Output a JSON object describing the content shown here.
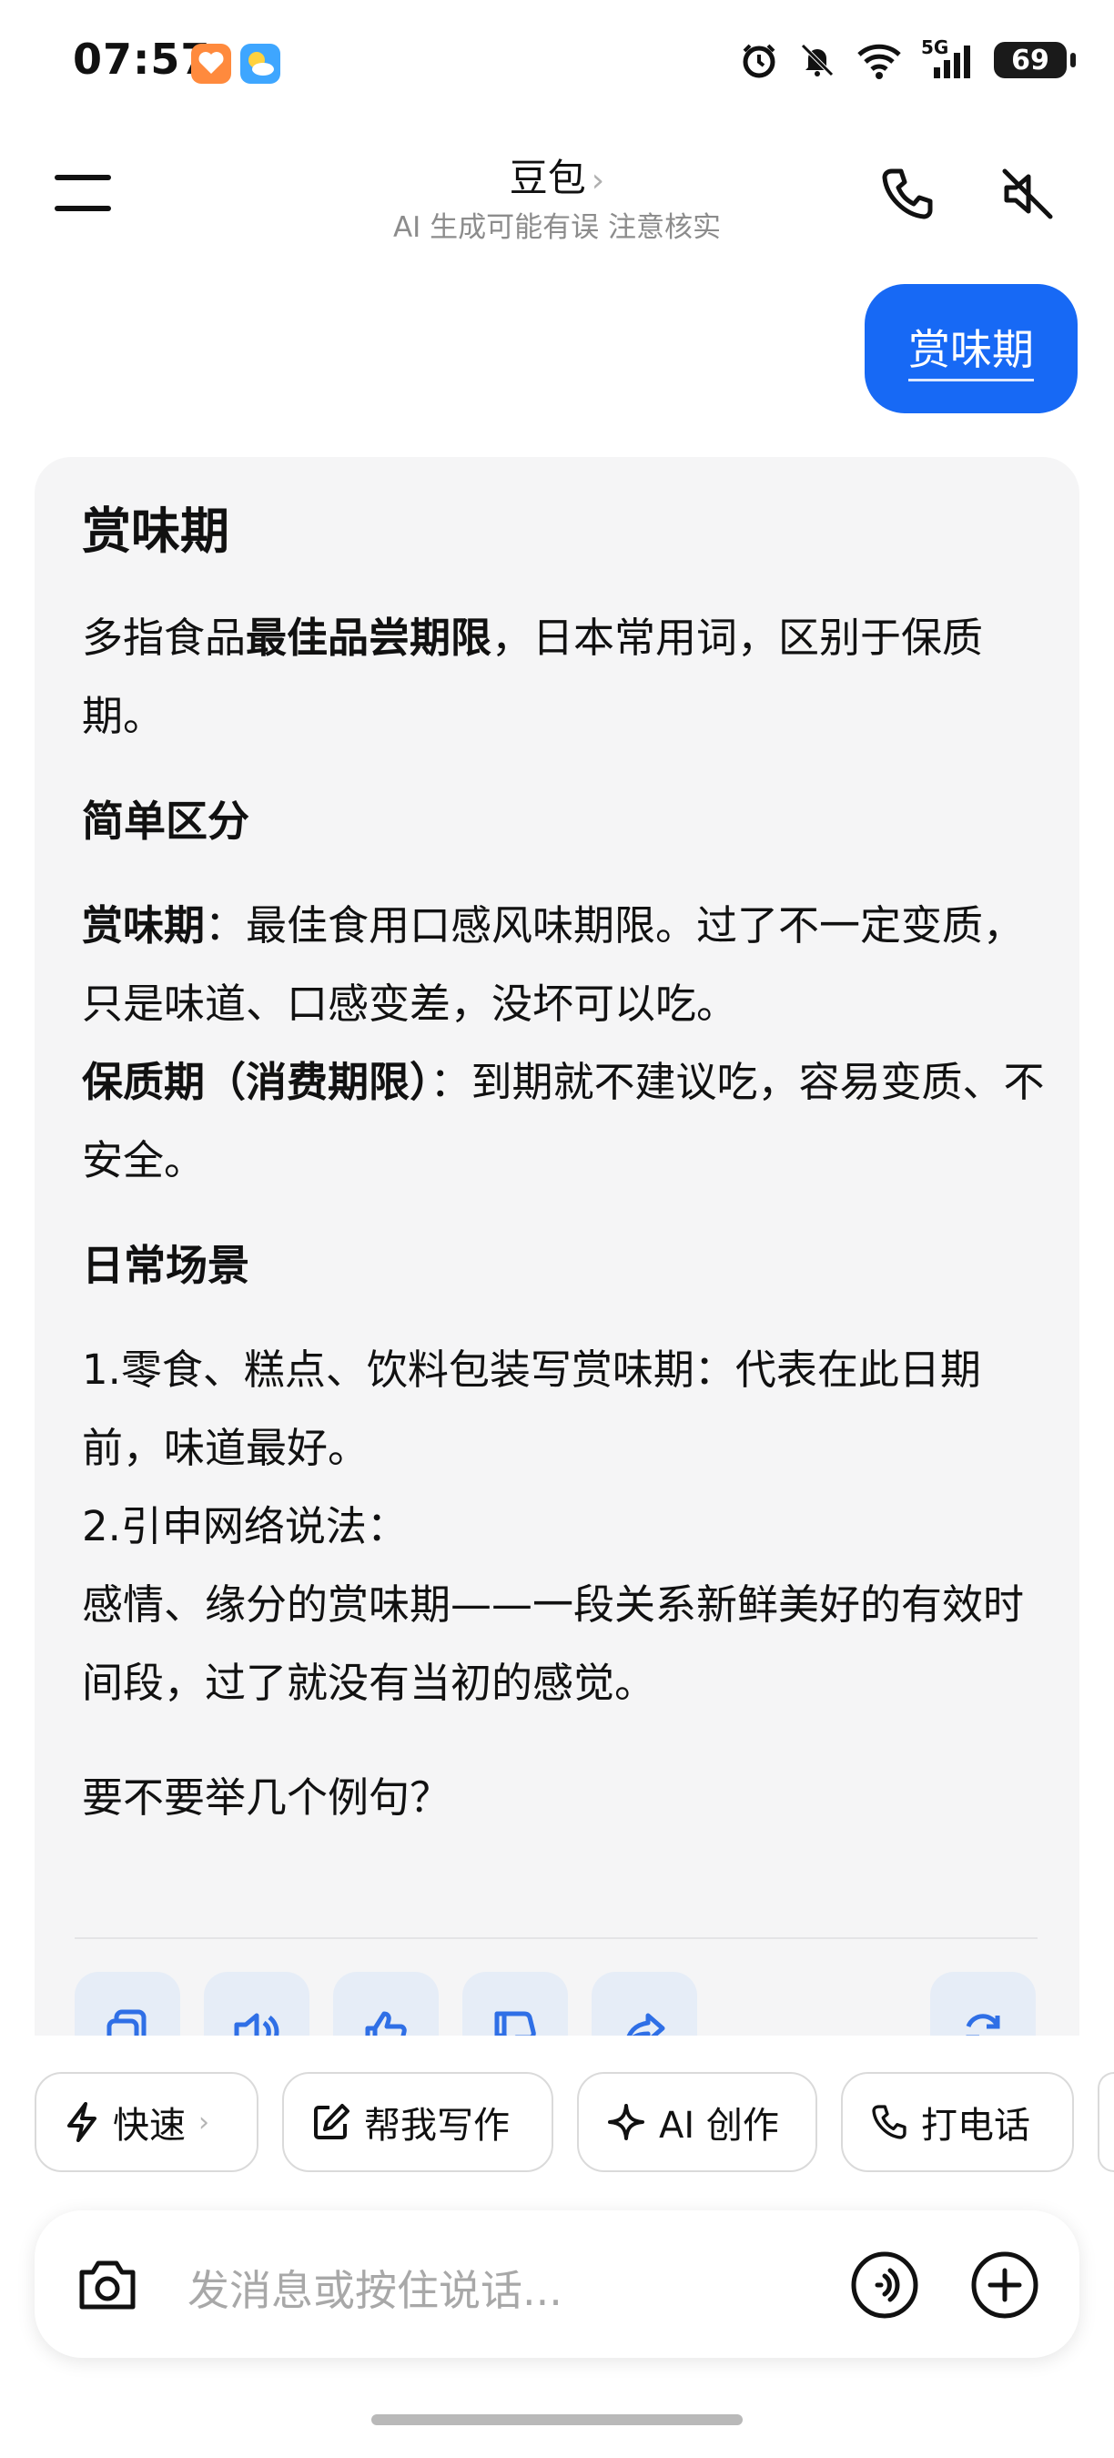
{
  "status_bar": {
    "time": "07:57",
    "battery": "69",
    "network": "5G"
  },
  "header": {
    "title": "豆包",
    "title_chevron": "›",
    "subtitle": "AI 生成可能有误 注意核实"
  },
  "user_message": "赏味期",
  "reply": {
    "title": "赏味期",
    "intro_pre": "多指食品",
    "intro_bold": "最佳品尝期限",
    "intro_post": "，日本常用词，区别于保质期。",
    "section1_heading": "简单区分",
    "item1_term": "赏味期",
    "item1_text": "：最佳食用口感风味期限。过了不一定变质，只是味道、口感变差，没坏可以吃。",
    "item2_term": "保质期（消费期限）",
    "item2_text": "：到期就不建议吃，容易变质、不安全。",
    "section2_heading": "日常场景",
    "scene1": "1.零食、糕点、饮料包装写赏味期：代表在此日期前，味道最好。",
    "scene2_title": "2.引申网络说法：",
    "scene2_text": "感情、缘分的赏味期——一段关系新鲜美好的有效时间段，过了就没有当初的感觉。",
    "closing": "要不要举几个例句？"
  },
  "action_icons": [
    "copy-icon",
    "speaker-icon",
    "thumbs-up-icon",
    "thumbs-down-icon",
    "share-icon",
    "regenerate-icon"
  ],
  "chips": [
    {
      "label": "快速",
      "icon": "lightning-icon",
      "chevron": "›"
    },
    {
      "label": "帮我写作",
      "icon": "edit-icon"
    },
    {
      "label": "AI 创作",
      "icon": "sparkle-icon"
    },
    {
      "label": "打电话",
      "icon": "phone-icon"
    }
  ],
  "input": {
    "placeholder": "发消息或按住说话..."
  },
  "colors": {
    "accent": "#1769f5",
    "card_bg": "#f5f5f6",
    "action_bg": "#e6edf7",
    "action_icon": "#2f6fe6"
  }
}
